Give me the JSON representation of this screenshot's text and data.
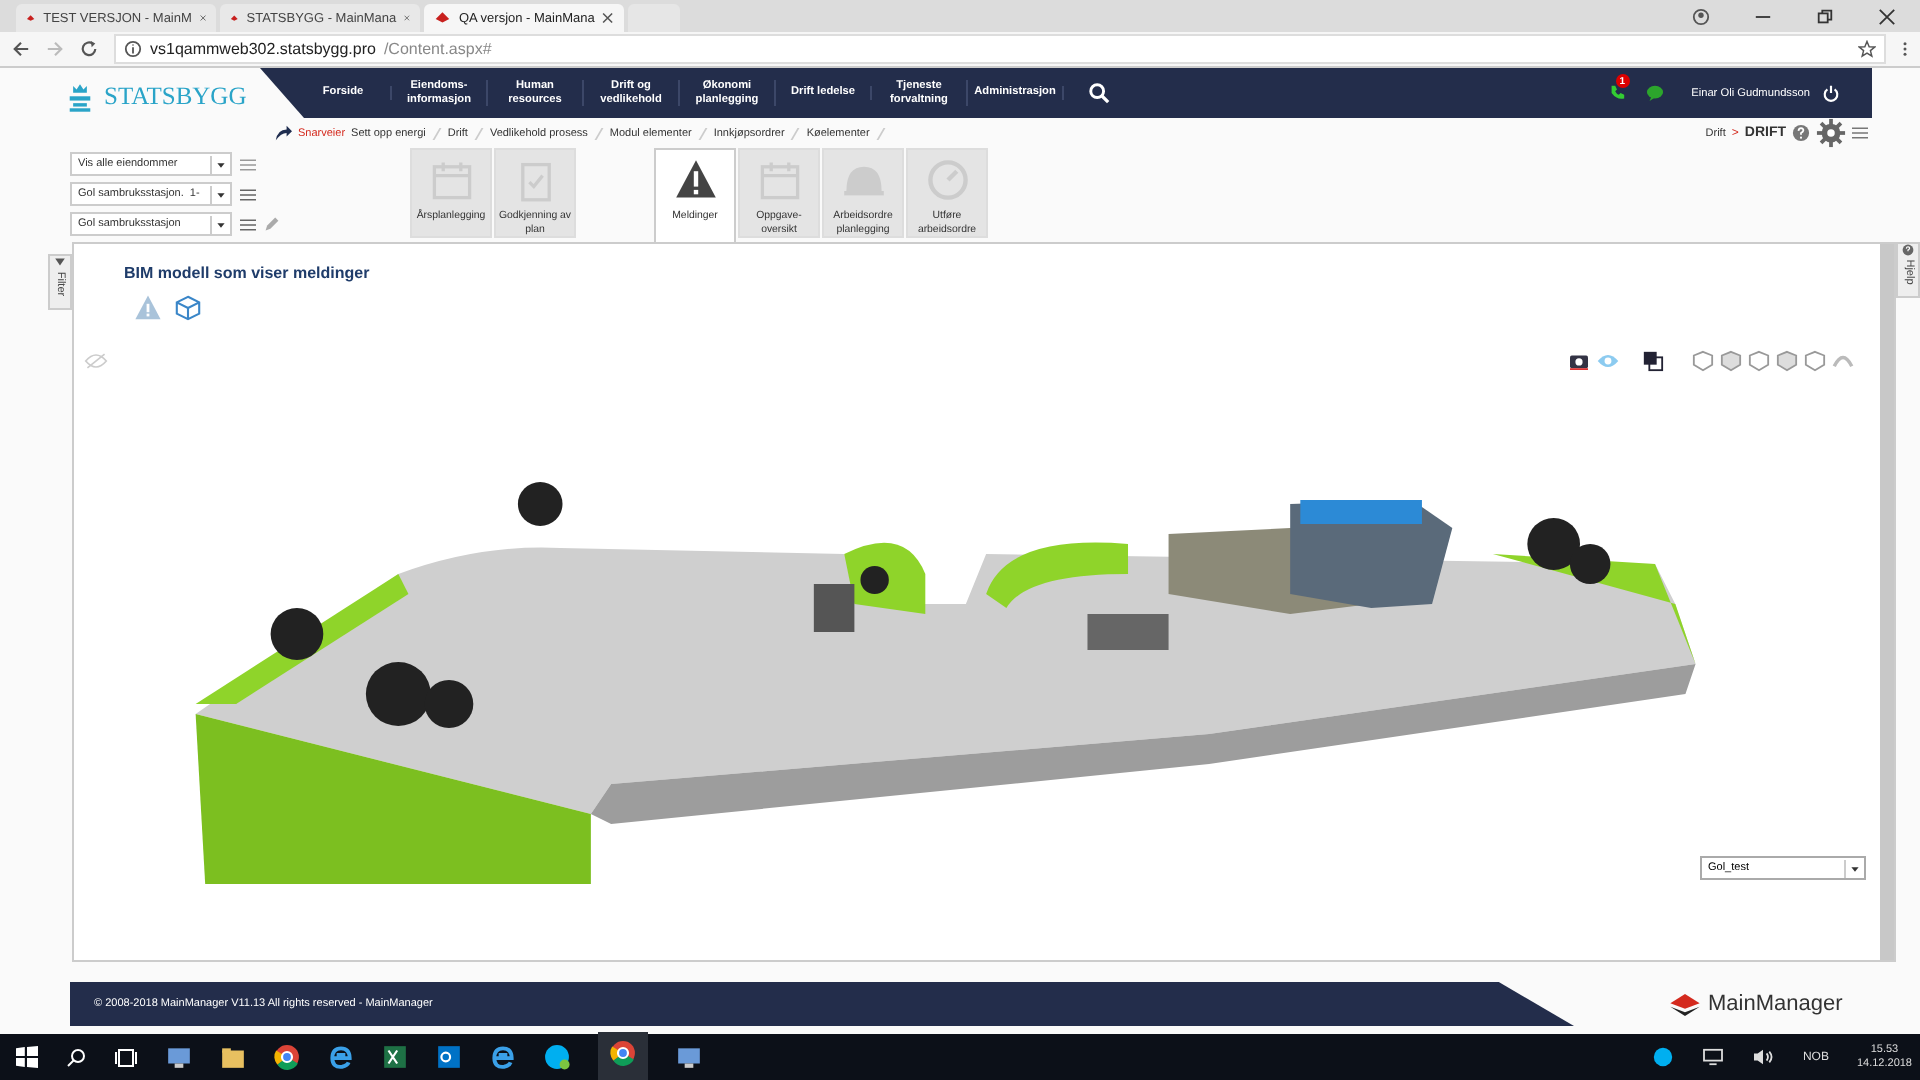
{
  "browser": {
    "tabs": [
      {
        "title": "TEST VERSJON - MainM",
        "selected": false
      },
      {
        "title": "STATSBYGG - MainMana",
        "selected": false
      },
      {
        "title": "QA versjon - MainMana",
        "selected": true
      }
    ],
    "url_host": "vs1qammweb302.statsbygg.pro",
    "url_path": "/Content.aspx#"
  },
  "header": {
    "logo": "STATSBYGG",
    "nav": [
      "Forside",
      "Eiendoms-informasjon",
      "Human resources",
      "Drift og vedlikehold",
      "Økonomi planlegging",
      "Drift ledelse",
      "Tjeneste forvaltning",
      "Administrasjon"
    ],
    "notification_count": "1",
    "user": "Einar Oli Gudmundsson"
  },
  "shortcuts": {
    "label": "Snarveier",
    "items": [
      "Sett opp energi",
      "Drift",
      "Vedlikehold prosess",
      "Modul elementer",
      "Innkjøpsordrer",
      "Køelementer"
    ]
  },
  "breadcrumb": {
    "parent": "Drift",
    "separator": ">",
    "current": "DRIFT"
  },
  "filters": [
    "Vis alle eiendommer",
    "Gol sambruksstasjon.  1-",
    "Gol sambruksstasjon"
  ],
  "tiles": [
    {
      "label": "Årsplanlegging",
      "kind": "calendar",
      "selected": false
    },
    {
      "label": "Godkjenning av plan",
      "kind": "clipboard",
      "selected": false
    },
    {
      "label": "Meldinger",
      "kind": "warning",
      "selected": true
    },
    {
      "label": "Oppgave-oversikt",
      "kind": "calendar",
      "selected": false
    },
    {
      "label": "Arbeidsordre planlegging",
      "kind": "helmet",
      "selected": false
    },
    {
      "label": "Utføre arbeidsordre",
      "kind": "gauge",
      "selected": false
    }
  ],
  "side_tabs": {
    "left": "Filter",
    "right": "Hjelp"
  },
  "panel": {
    "title": "BIM modell som viser meldinger",
    "model_select": "Gol_test"
  },
  "footer": {
    "copyright": "© 2008-2018 MainManager V11.13 All rights reserved - MainManager",
    "brand": "MainManager"
  },
  "taskbar": {
    "language": "NOB",
    "time": "15.53",
    "date": "14.12.2018"
  }
}
